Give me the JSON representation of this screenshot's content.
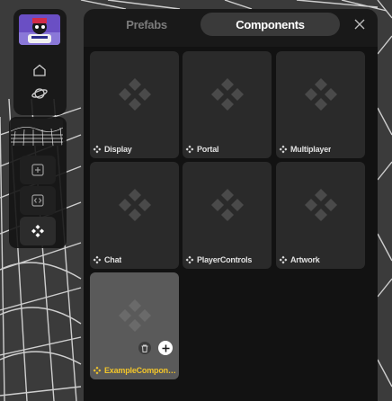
{
  "tabs": [
    {
      "label": "Prefabs",
      "active": false
    },
    {
      "label": "Components",
      "active": true
    }
  ],
  "components": [
    {
      "label": "Display",
      "selected": false
    },
    {
      "label": "Portal",
      "selected": false
    },
    {
      "label": "Multiplayer",
      "selected": false
    },
    {
      "label": "Chat",
      "selected": false
    },
    {
      "label": "PlayerControls",
      "selected": false
    },
    {
      "label": "Artwork",
      "selected": false
    },
    {
      "label": "ExampleCompone...",
      "selected": true
    }
  ],
  "icons": {
    "home": "home-icon",
    "planet": "planet-icon",
    "add": "plus-square-icon",
    "code": "code-icon",
    "components": "components-icon",
    "close": "close-icon",
    "trash": "trash-icon",
    "plus": "plus-icon"
  },
  "colors": {
    "accent": "#f2c52a",
    "panel": "#181818",
    "card": "#2a2a2a",
    "active_tab": "#3a3a3a"
  }
}
